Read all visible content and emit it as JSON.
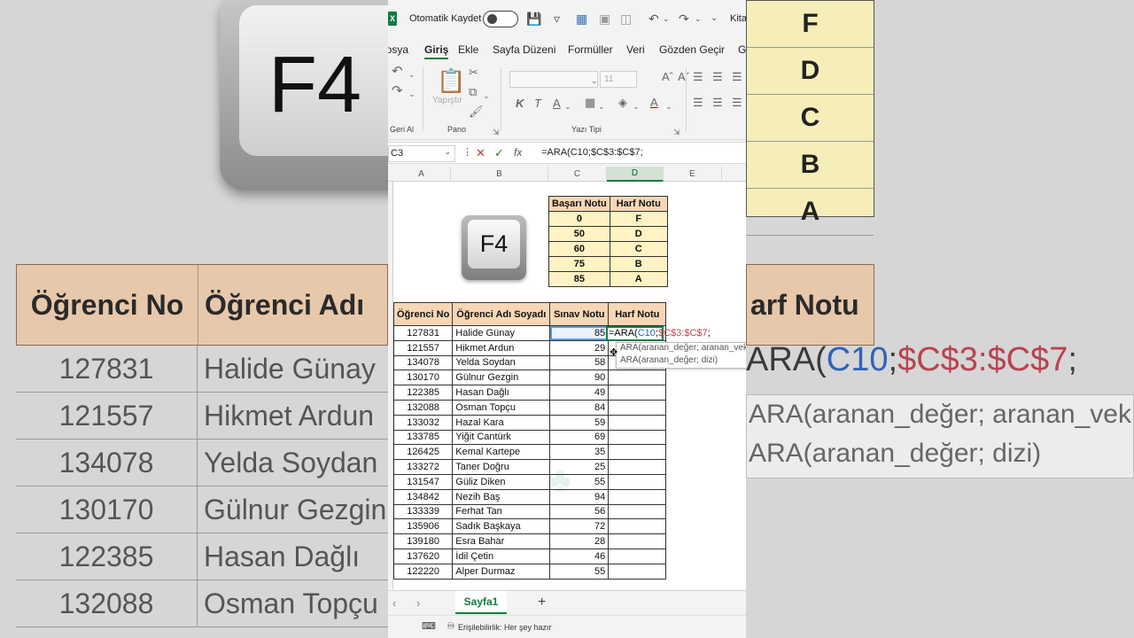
{
  "titlebar": {
    "autosave_label": "Otomatik Kaydet",
    "book_title": "Kita"
  },
  "menu": [
    "Dosya",
    "Giriş",
    "Ekle",
    "Sayfa Düzeni",
    "Formüller",
    "Veri",
    "Gözden Geçir",
    "Gö"
  ],
  "ribbon": {
    "undo_group_label": "Geri Al",
    "clipboard_group_label": "Pano",
    "font_group_label": "Yazı Tipi",
    "paste_label": "Yapıştır",
    "font_size": "11",
    "bold": "K",
    "italic": "T",
    "underline": "A"
  },
  "formula_bar": {
    "name_box": "C3",
    "fx": "fx",
    "formula": "=ARA(C10;$C$3:$C$7;"
  },
  "columns": [
    "A",
    "B",
    "C",
    "D",
    "E"
  ],
  "keycap_label": "F4",
  "grade_table": {
    "headers": [
      "Başarı Notu",
      "Harf Notu"
    ],
    "rows": [
      [
        "0",
        "F"
      ],
      [
        "50",
        "D"
      ],
      [
        "60",
        "C"
      ],
      [
        "75",
        "B"
      ],
      [
        "85",
        "A"
      ]
    ]
  },
  "student_table": {
    "headers": [
      "Öğrenci No",
      "Öğrenci Adı Soyadı",
      "Sınav Notu",
      "Harf Notu"
    ],
    "rows": [
      [
        "127831",
        "Halide Günay",
        "85"
      ],
      [
        "121557",
        "Hikmet Ardun",
        "29"
      ],
      [
        "134078",
        "Yelda Soydan",
        "58"
      ],
      [
        "130170",
        "Gülnur Gezgin",
        "90"
      ],
      [
        "122385",
        "Hasan Dağlı",
        "49"
      ],
      [
        "132088",
        "Osman Topçu",
        "84"
      ],
      [
        "133032",
        "Hazal Kara",
        "59"
      ],
      [
        "133785",
        "Yiğit Cantürk",
        "69"
      ],
      [
        "126425",
        "Kemal Kartepe",
        "35"
      ],
      [
        "133272",
        "Taner Doğru",
        "25"
      ],
      [
        "131547",
        "Güliz Diken",
        "55"
      ],
      [
        "134842",
        "Nezih Baş",
        "94"
      ],
      [
        "133339",
        "Ferhat Tan",
        "56"
      ],
      [
        "135906",
        "Sadık Başkaya",
        "72"
      ],
      [
        "139180",
        "Esra Bahar",
        "28"
      ],
      [
        "137620",
        "İdil Çetin",
        "46"
      ],
      [
        "122220",
        "Alper Durmaz",
        "55"
      ]
    ]
  },
  "edit_cell": {
    "prefix": "=ARA(",
    "arg1": "C10",
    "sep1": ";",
    "arg2": "$C$3:$C$7",
    "sep2": ";"
  },
  "tooltip": {
    "line1": "ARA(aranan_değer; aranan_vektör; ...",
    "line2": "ARA(aranan_değer; dizi)"
  },
  "sheet_tab": "Sayfa1",
  "status": "Erişilebilirlik: Her şey hazır",
  "background": {
    "header1": "Öğrenci No",
    "header2": "Öğrenci Adı",
    "header3": "arf Notu",
    "formula": "ARA(C10;$C$3:$C$7;",
    "tip1": "ARA(aranan_değer; aranan_vek",
    "tip2": "ARA(aranan_değer; dizi)",
    "grades": [
      "F",
      "D",
      "C",
      "B",
      "A"
    ]
  },
  "colors": {
    "excel_green": "#107c41",
    "header_fill": "#f7d6b5",
    "grade_fill": "#fff3c4"
  }
}
